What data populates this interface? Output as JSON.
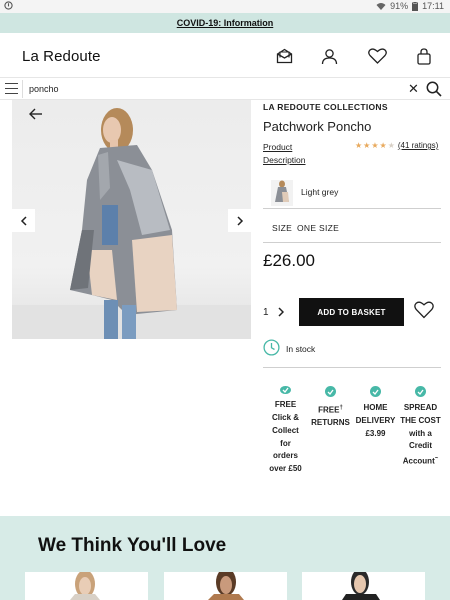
{
  "status_bar": {
    "battery": "91%",
    "time": "17:11"
  },
  "banner": {
    "text": "COVID-19: Information"
  },
  "header": {
    "logo": "La Redoute"
  },
  "search": {
    "query": "poncho"
  },
  "product": {
    "brand": "LA REDOUTE COLLECTIONS",
    "title": "Patchwork Poncho",
    "description_link": "Product Description",
    "rating_value": 4.5,
    "rating_link": "(41 ratings)",
    "colour": "Light grey",
    "size_label": "SIZE",
    "size_value": "ONE SIZE",
    "price": "£26.00",
    "quantity": "1",
    "add_button": "ADD TO BASKET",
    "stock": "In stock"
  },
  "benefits": [
    {
      "text": "FREE Click & Collect for orders over £50"
    },
    {
      "text": "FREE",
      "sup": "†",
      "text2": "RETURNS"
    },
    {
      "text": "HOME DELIVERY £3.99"
    },
    {
      "text": "SPREAD THE COST with a Credit Account",
      "sup": "~"
    }
  ],
  "recommendations": {
    "title": "We Think You'll Love"
  },
  "colors": {
    "banner": "#cfe6e1",
    "accent": "#47b8a7",
    "reco_bg": "#d7ebe7",
    "star": "#e8a95c"
  }
}
